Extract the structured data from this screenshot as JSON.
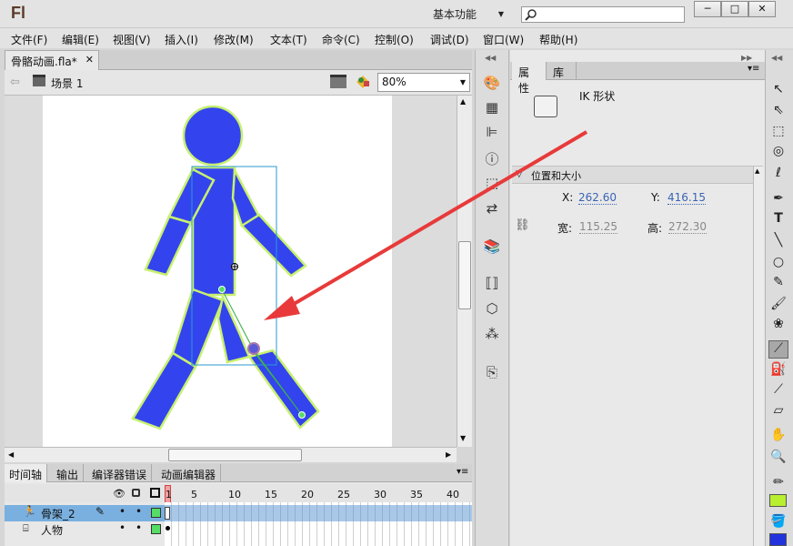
{
  "app": {
    "logo": "Fl",
    "workspace": "基本功能",
    "search_placeholder": ""
  },
  "window_buttons": [
    "─",
    "□",
    "✕"
  ],
  "menu": [
    "文件(F)",
    "编辑(E)",
    "视图(V)",
    "插入(I)",
    "修改(M)",
    "文本(T)",
    "命令(C)",
    "控制(O)",
    "调试(D)",
    "窗口(W)",
    "帮助(H)"
  ],
  "document": {
    "tab": "骨骼动画.fla*",
    "scene": "场景 1",
    "zoom": "80%"
  },
  "timeline": {
    "tabs": [
      "时间轴",
      "输出",
      "编译器错误",
      "动画编辑器"
    ],
    "frame_numbers": [
      "1",
      "5",
      "10",
      "15",
      "20",
      "25",
      "30",
      "35",
      "40"
    ],
    "layers": [
      {
        "name": "骨架_2",
        "selected": true
      },
      {
        "name": "人物",
        "selected": false
      }
    ]
  },
  "properties": {
    "tabs": [
      "属性",
      "库"
    ],
    "object_type": "IK 形状",
    "section": "位置和大小",
    "x_label": "X:",
    "x": "262.60",
    "y_label": "Y:",
    "y": "416.15",
    "w_label": "宽:",
    "w": "115.25",
    "h_label": "高:",
    "h": "272.30"
  },
  "colors": {
    "figure": "#3344ee",
    "outline": "#c8f070",
    "bone": "#55dd66",
    "arrow": "#e83a3a",
    "stroke_swatch": "#b8f030",
    "fill_swatch": "#2233dd"
  }
}
